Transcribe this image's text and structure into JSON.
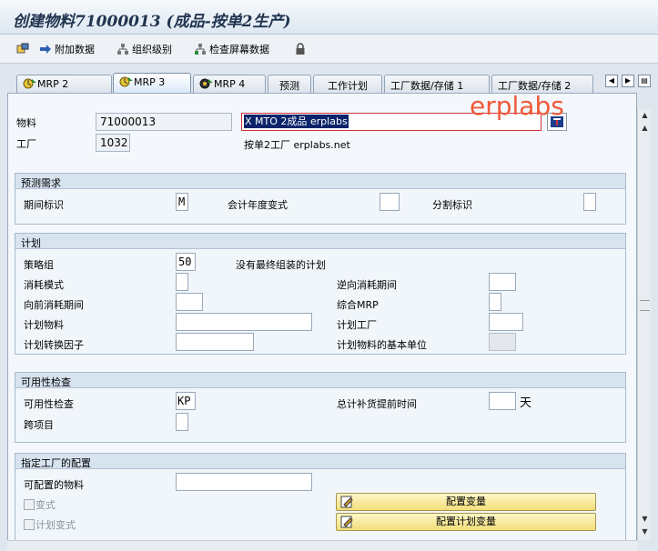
{
  "window": {
    "title": "创建物料71000013 (成品-按单2生产)"
  },
  "toolbar": {
    "items": [
      {
        "label": "附加数据",
        "icon": "arrow-right-icon"
      },
      {
        "label": "组织级别",
        "icon": "org-levels-icon"
      },
      {
        "label": "检查屏幕数据",
        "icon": "check-screen-icon"
      }
    ],
    "lock_icon": "lock-icon"
  },
  "tabs": [
    {
      "label": "MRP 2",
      "icon": "mrp-icon"
    },
    {
      "label": "MRP 3",
      "icon": "mrp-icon",
      "active": true
    },
    {
      "label": "MRP 4",
      "icon": "mrp-icon"
    },
    {
      "label": "预测"
    },
    {
      "label": "工作计划"
    },
    {
      "label": "工厂数据/存储 1"
    },
    {
      "label": "工厂数据/存储 2"
    }
  ],
  "header": {
    "material_label": "物料",
    "material_value": "71000013",
    "material_desc": "X MTO 2成品 erplabs",
    "plant_label": "工厂",
    "plant_value": "1032",
    "plant_desc": "按单2工厂 erplabs.net",
    "watermark": "erplabs"
  },
  "forecast": {
    "title": "预测需求",
    "period_label": "期间标识",
    "period_value": "M",
    "fiscal_variant_label": "会计年度变式",
    "fiscal_variant_value": "",
    "split_label": "分割标识",
    "split_value": ""
  },
  "planning": {
    "title": "计划",
    "strategy_group_label": "策略组",
    "strategy_group_value": "50",
    "strategy_group_desc": "没有最终组装的计划",
    "consumption_mode_label": "消耗模式",
    "consumption_mode_value": "",
    "backward_period_label": "逆向消耗期间",
    "backward_period_value": "",
    "forward_period_label": "向前消耗期间",
    "forward_period_value": "",
    "mixed_mrp_label": "综合MRP",
    "mixed_mrp_value": "",
    "planning_material_label": "计划物料",
    "planning_material_value": "",
    "planning_plant_label": "计划工厂",
    "planning_plant_value": "",
    "conv_factor_label": "计划转换因子",
    "conv_factor_value": "",
    "base_unit_label": "计划物料的基本单位",
    "base_unit_value": ""
  },
  "availability": {
    "title": "可用性检查",
    "check_label": "可用性检查",
    "check_value": "KP",
    "replenish_label": "总计补货提前时间",
    "replenish_value": "",
    "replenish_unit": "天",
    "cross_project_label": "跨项目",
    "cross_project_value": ""
  },
  "config": {
    "title": "指定工厂的配置",
    "configurable_label": "可配置的物料",
    "configurable_value": "",
    "variant_label": "变式",
    "plan_variant_label": "计划变式",
    "config_variant_button": "配置变量",
    "config_plan_variant_button": "配置计划变量"
  }
}
